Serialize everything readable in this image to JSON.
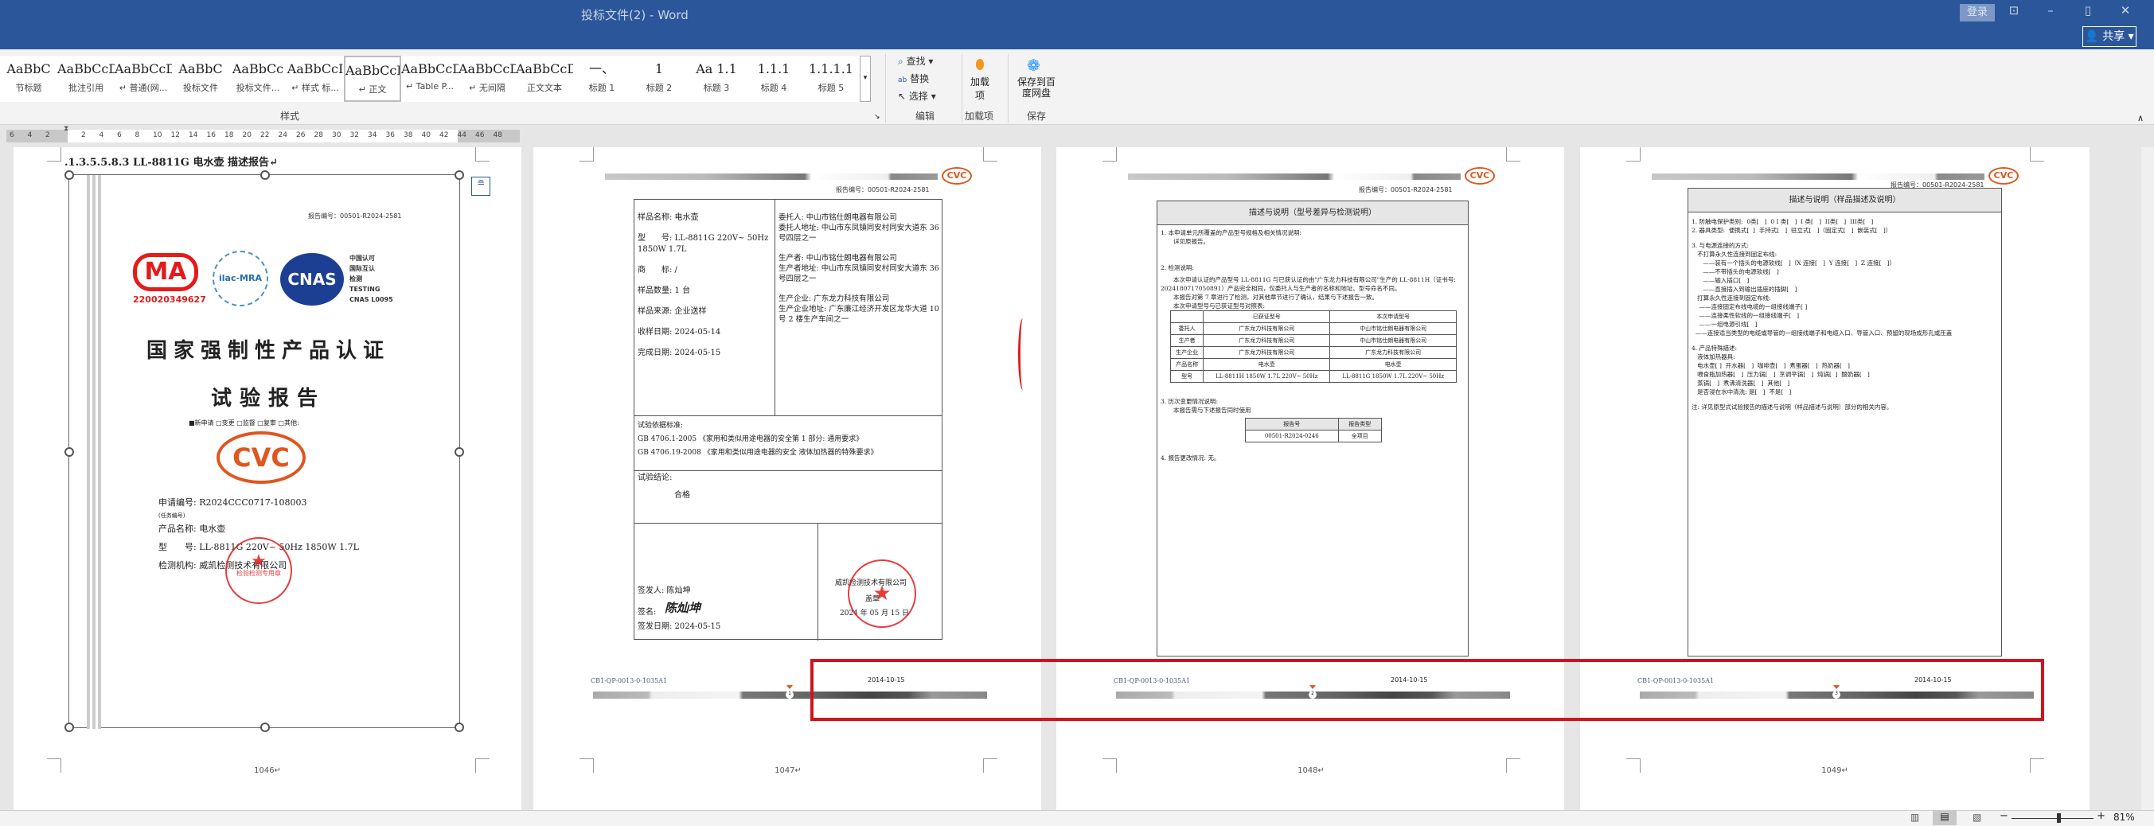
{
  "window": {
    "title": "投标文件(2)  -  Word",
    "login": "登录",
    "share": "共享",
    "min": "–",
    "max": "▯",
    "close": "✕",
    "ribbon_display": "⊡",
    "collapse": "∧"
  },
  "ribbon": {
    "styles": [
      {
        "preview": "AaBbC",
        "label": "节标题"
      },
      {
        "preview": "AaBbCcDd",
        "label": "批注引用"
      },
      {
        "preview": "AaBbCcDc",
        "label": "↵ 普通(网..."
      },
      {
        "preview": "AaBbC",
        "label": "投标文件"
      },
      {
        "preview": "AaBbCc",
        "label": "投标文件..."
      },
      {
        "preview": "AaBbCcI",
        "label": "↵ 样式 标..."
      },
      {
        "preview": "AaBbCcDdI",
        "label": "↵ 正文"
      },
      {
        "preview": "AaBbCcDc",
        "label": "↵ Table P..."
      },
      {
        "preview": "AaBbCcDdI",
        "label": "↵ 无间隔"
      },
      {
        "preview": "AaBbCcDdI",
        "label": "正文文本"
      },
      {
        "preview": "一、",
        "label": "标题 1"
      },
      {
        "preview": "1",
        "label": "标题 2"
      },
      {
        "preview": "Aa 1.1",
        "label": "标题 3"
      },
      {
        "preview": "1.1.1",
        "label": "标题 4"
      },
      {
        "preview": "1.1.1.1",
        "label": "标题 5"
      }
    ],
    "styles_group": "样式",
    "find": "查找",
    "replace": "替换",
    "select": "选择",
    "editing_group": "编辑",
    "addins": "加载项",
    "addins_group": "加载项",
    "save_baidu": "保存到百度网盘",
    "save_group": "保存"
  },
  "ruler": {
    "ticks": [
      "6",
      "4",
      "2",
      "",
      "2",
      "4",
      "6",
      "8",
      "10",
      "12",
      "14",
      "16",
      "18",
      "20",
      "22",
      "24",
      "26",
      "28",
      "30",
      "32",
      "34",
      "36",
      "38",
      "40",
      "42",
      "44",
      "46",
      "48"
    ]
  },
  "page1": {
    "heading": ".1.3.5.5.8.3   LL-8811G 电水壶   描述报告↵",
    "report_no": "报告编号：00501-R2024-2581",
    "cma_number": "220020349627",
    "cnas_text": [
      "中国认可",
      "国际互认",
      "检测",
      "TESTING",
      "CNAS L0095"
    ],
    "title": "国家强制性产品认证",
    "subtitle": "试验报告",
    "options": "■新申请 □变更 □监督 □复审 □其他:",
    "cvc": "CVC",
    "fields": [
      {
        "label": "申请编号:",
        "value": "R2024CCC0717-108003"
      },
      {
        "label": "(任务编号)",
        "value": ""
      },
      {
        "label": "产品名称:",
        "value": "电水壶"
      },
      {
        "label": "型　　号:",
        "value": "LL-8811G 220V~ 50Hz 1850W 1.7L"
      },
      {
        "label": "检测机构:",
        "value": "威凯检测技术有限公司"
      }
    ],
    "stamp_text": "检验检测专用章",
    "page_number": "1046↵"
  },
  "page2": {
    "report_no": "报告编号：00501-R2024-2581",
    "left": [
      "样品名称: 电水壶",
      "型　　号: LL-8811G 220V~ 50Hz 1850W 1.7L",
      "商　　标: /",
      "样品数量:  1 台",
      "样品来源: 企业送样",
      "收样日期: 2024-05-14",
      "完成日期: 2024-05-15"
    ],
    "right": [
      "委托人: 中山市铭仕朗电器有限公司",
      "委托人地址: 中山市东凤镇同安村同安大道东 36 号四层之一",
      "生产者: 中山市铭仕朗电器有限公司",
      "生产者地址: 中山市东凤镇同安村同安大道东 36 号四层之一",
      "生产企业: 广东龙力科技有限公司",
      "生产企业地址: 广东廉江经济开发区龙华大道 10 号 2 楼生产车间之一"
    ],
    "standards_label": "试验依据标准:",
    "standards": [
      "GB 4706.1-2005 《家用和类似用途电器的安全第 1 部分: 通用要求》",
      "GB 4706.19-2008 《家用和类似用途电器的安全 液体加热器的特殊要求》"
    ],
    "conclusion_label": "试验结论:",
    "conclusion": "合格",
    "issuer": "签发人: 陈灿坤",
    "signature_label": "签名:",
    "signature": "陈灿坤",
    "issue_date": "签发日期: 2024-05-15",
    "company": "威凯检测技术有限公司",
    "seal": "盖章",
    "seal_date": "2024 年 05 月 15 日",
    "page_number": "1047↵"
  },
  "page3": {
    "report_no": "报告编号：00501-R2024-2581",
    "title": "描述与说明（型号差异与检测说明）",
    "s1": "1. 本申请单元所覆盖的产品型号规格及相关情况说明:",
    "s1b": "详见原报告。",
    "s2": "2. 检测说明:",
    "s2body": [
      "本次申请认证的产品型号 LL-8811G 与已获认证的由\"广东龙力科技有限公司\"生产的 LL-8811H（证书号: 2024180717050891）产品完全相同，仅委托人与生产者的名称和地址、型号命名不同。",
      "本报告对第 7 章进行了检测，对其他章节进行了确认，结果与下述报告一致。",
      "本次申请型号与已获证型号对照表:"
    ],
    "cmp_headers": [
      "",
      "已获证型号",
      "本次申请型号"
    ],
    "cmp_rows": [
      [
        "委托人",
        "广东龙力科技有限公司",
        "中山市铭仕朗电器有限公司"
      ],
      [
        "生产者",
        "广东龙力科技有限公司",
        "中山市铭仕朗电器有限公司"
      ],
      [
        "生产企业",
        "广东龙力科技有限公司",
        "广东龙力科技有限公司"
      ],
      [
        "产品名称",
        "电水壶",
        "电水壶"
      ],
      [
        "型号",
        "LL-8811H 1850W 1.7L 220V~ 50Hz",
        "LL-8811G 1850W 1.7L 220V~ 50Hz"
      ]
    ],
    "s3": "3. 历次变更情况说明:",
    "s3b": "本报告需与下述报告同时使用",
    "rep_headers": [
      "报告号",
      "报告类型"
    ],
    "rep_row": [
      "00501-R2024-0246",
      "全项目"
    ],
    "s4": "4. 报告更改情况: 无。",
    "page_number": "1048↵"
  },
  "page4": {
    "report_no": "报告编号：00501-R2024-2581",
    "title": "描述与说明（样品描述及说明）",
    "lines": [
      "1. 防触电保护类别:  0类[   ]  0 I 类[   ]  I 类[   ]  II类[   ]  III类[   ]",
      "2. 器具类型:  便携式[  ]  手持式[   ]  驻立式[   ]（固定式[   ]  嵌装式[   ]）",
      "3. 与电源连接的方式:",
      "   不打算永久性连接到固定布线:",
      "      ——装有一个插头的电源软线[   ]（X 连接[   ]  Y 连接[   ]  Z 连接[   ]）",
      "      ——不带插头的电源软线[   ]",
      "      ——输入插口[   ]",
      "      ——直接插入到输出插座的插脚[   ]",
      "   打算永久性连接到固定布线:",
      "    ——连接固定布线电缆的一组接线端子[ ]",
      "    ——连接柔性软线的一组接线端子[   ]",
      "    ——一组电源引线[   ]",
      "  ——连接适当类型的电缆或导管的一组接线端子和电缆入口、导管入口、预留的现场成形孔或压盖",
      "4. 产品特殊描述:",
      "   液体加热器具:",
      "   电水壶[ ]  开水器[   ]  咖啡壶[   ]  煮蛋器[   ]  热奶器[   ]",
      "   喂食瓶加热器[   ]  压力锅[   ]  烹调平锅[   ]  炖锅[  ]  酸奶器[   ]",
      "   蒸锅[   ]  煮沸清洗器[   ]  其他[   ]",
      "   是否浸在水中清洗: 是[   ]  不是[   ]",
      "注: 详见原型式试验报告的描述与说明（样品描述与说明）部分的相关内容。"
    ],
    "page_number": "1049↵"
  },
  "footer": {
    "code": "CB1-QP-0013-0-1035A1",
    "date": "2014-10-15",
    "marks": [
      "1",
      "2",
      "3"
    ]
  },
  "status": {
    "zoom": "81%",
    "zoom_fraction": 0.55,
    "minus": "−",
    "plus": "+"
  },
  "colors": {
    "titlebar": "#2b579a",
    "highlight": "#d0141f",
    "cvc": "#e0561f",
    "stamp": "#e31b1b"
  }
}
